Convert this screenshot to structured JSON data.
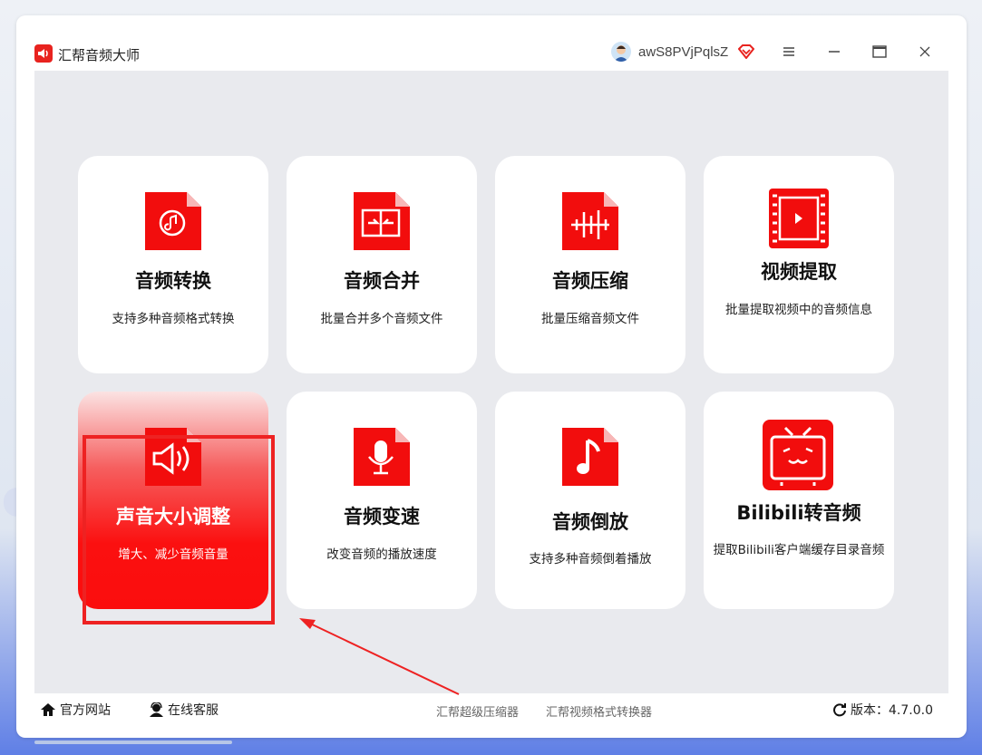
{
  "app": {
    "title": "汇帮音频大师",
    "username": "awS8PVjPqlsZ"
  },
  "colors": {
    "brand_red": "#f20d0d",
    "card_bg": "#ffffff",
    "content_bg": "#e9eaee",
    "highlight": "#ee2222"
  },
  "cards": [
    {
      "title": "音频转换",
      "desc": "支持多种音频格式转换",
      "icon": "audio-convert-icon"
    },
    {
      "title": "音频合并",
      "desc": "批量合并多个音频文件",
      "icon": "audio-merge-icon"
    },
    {
      "title": "音频压缩",
      "desc": "批量压缩音频文件",
      "icon": "audio-compress-icon"
    },
    {
      "title": "视频提取",
      "desc": "批量提取视频中的音频信息",
      "icon": "video-extract-icon"
    },
    {
      "title": "声音大小调整",
      "desc": "增大、减少音频音量",
      "icon": "volume-icon",
      "active": true
    },
    {
      "title": "音频变速",
      "desc": "改变音频的播放速度",
      "icon": "microphone-icon"
    },
    {
      "title": "音频倒放",
      "desc": "支持多种音频倒着播放",
      "icon": "music-note-icon"
    },
    {
      "title": "Bilibili转音频",
      "desc": "提取Bilibili客户端缓存目录音频",
      "icon": "bilibili-tv-icon"
    }
  ],
  "statusbar": {
    "website": "官方网站",
    "support": "在线客服",
    "link1": "汇帮超级压缩器",
    "link2": "汇帮视频格式转换器",
    "version": "版本：4.7.0.0"
  }
}
